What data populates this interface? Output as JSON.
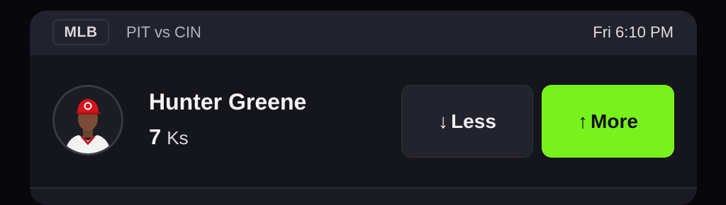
{
  "header": {
    "league": "MLB",
    "matchup": "PIT vs CIN",
    "time": "Fri 6:10 PM"
  },
  "player": {
    "name": "Hunter Greene",
    "line_value": "7",
    "stat_unit": "Ks",
    "avatar_icon": "player-headshot-icon"
  },
  "actions": {
    "less_arrow": "↓",
    "less_label": "Less",
    "more_arrow": "↑",
    "more_label": "More"
  },
  "colors": {
    "background": "#07070c",
    "card": "#15151c",
    "header": "#22222c",
    "more_accent": "#78f21d",
    "cap_red": "#d8141c"
  }
}
